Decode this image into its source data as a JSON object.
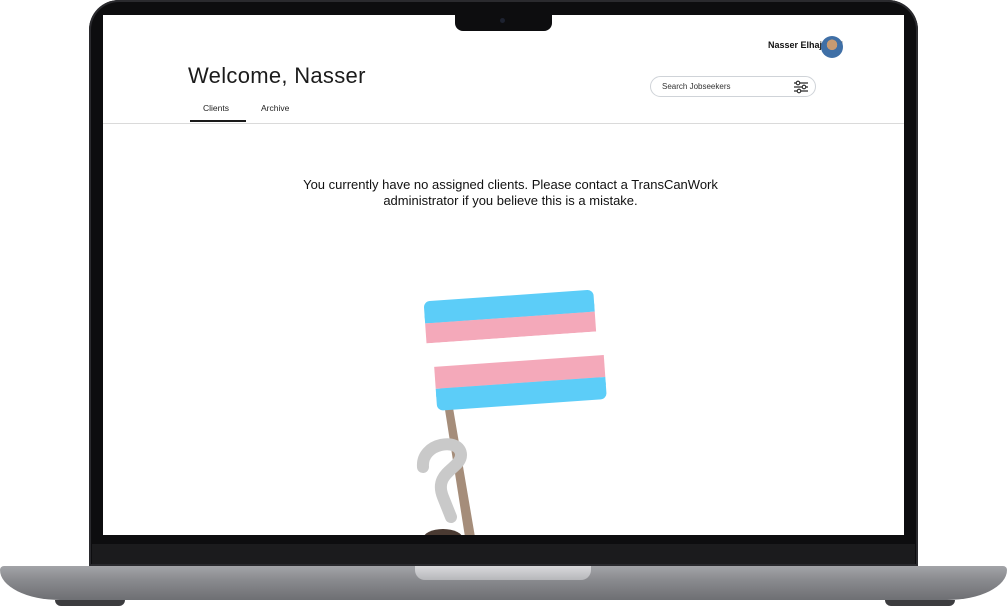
{
  "user": {
    "name": "Nasser Elhajjaoui"
  },
  "header": {
    "welcome": "Welcome, Nasser"
  },
  "search": {
    "placeholder": "Search Jobseekers"
  },
  "tabs": [
    {
      "label": "Clients",
      "active": true
    },
    {
      "label": "Archive",
      "active": false
    }
  ],
  "main": {
    "empty_message": "You currently have no assigned clients. Please contact a TransCanWork administrator if you believe this is a mistake."
  },
  "colors": {
    "flag_blue": "#5ccdf8",
    "flag_pink": "#f4a9ba",
    "flag_white": "#ffffff",
    "pole": "#a58d7a"
  }
}
